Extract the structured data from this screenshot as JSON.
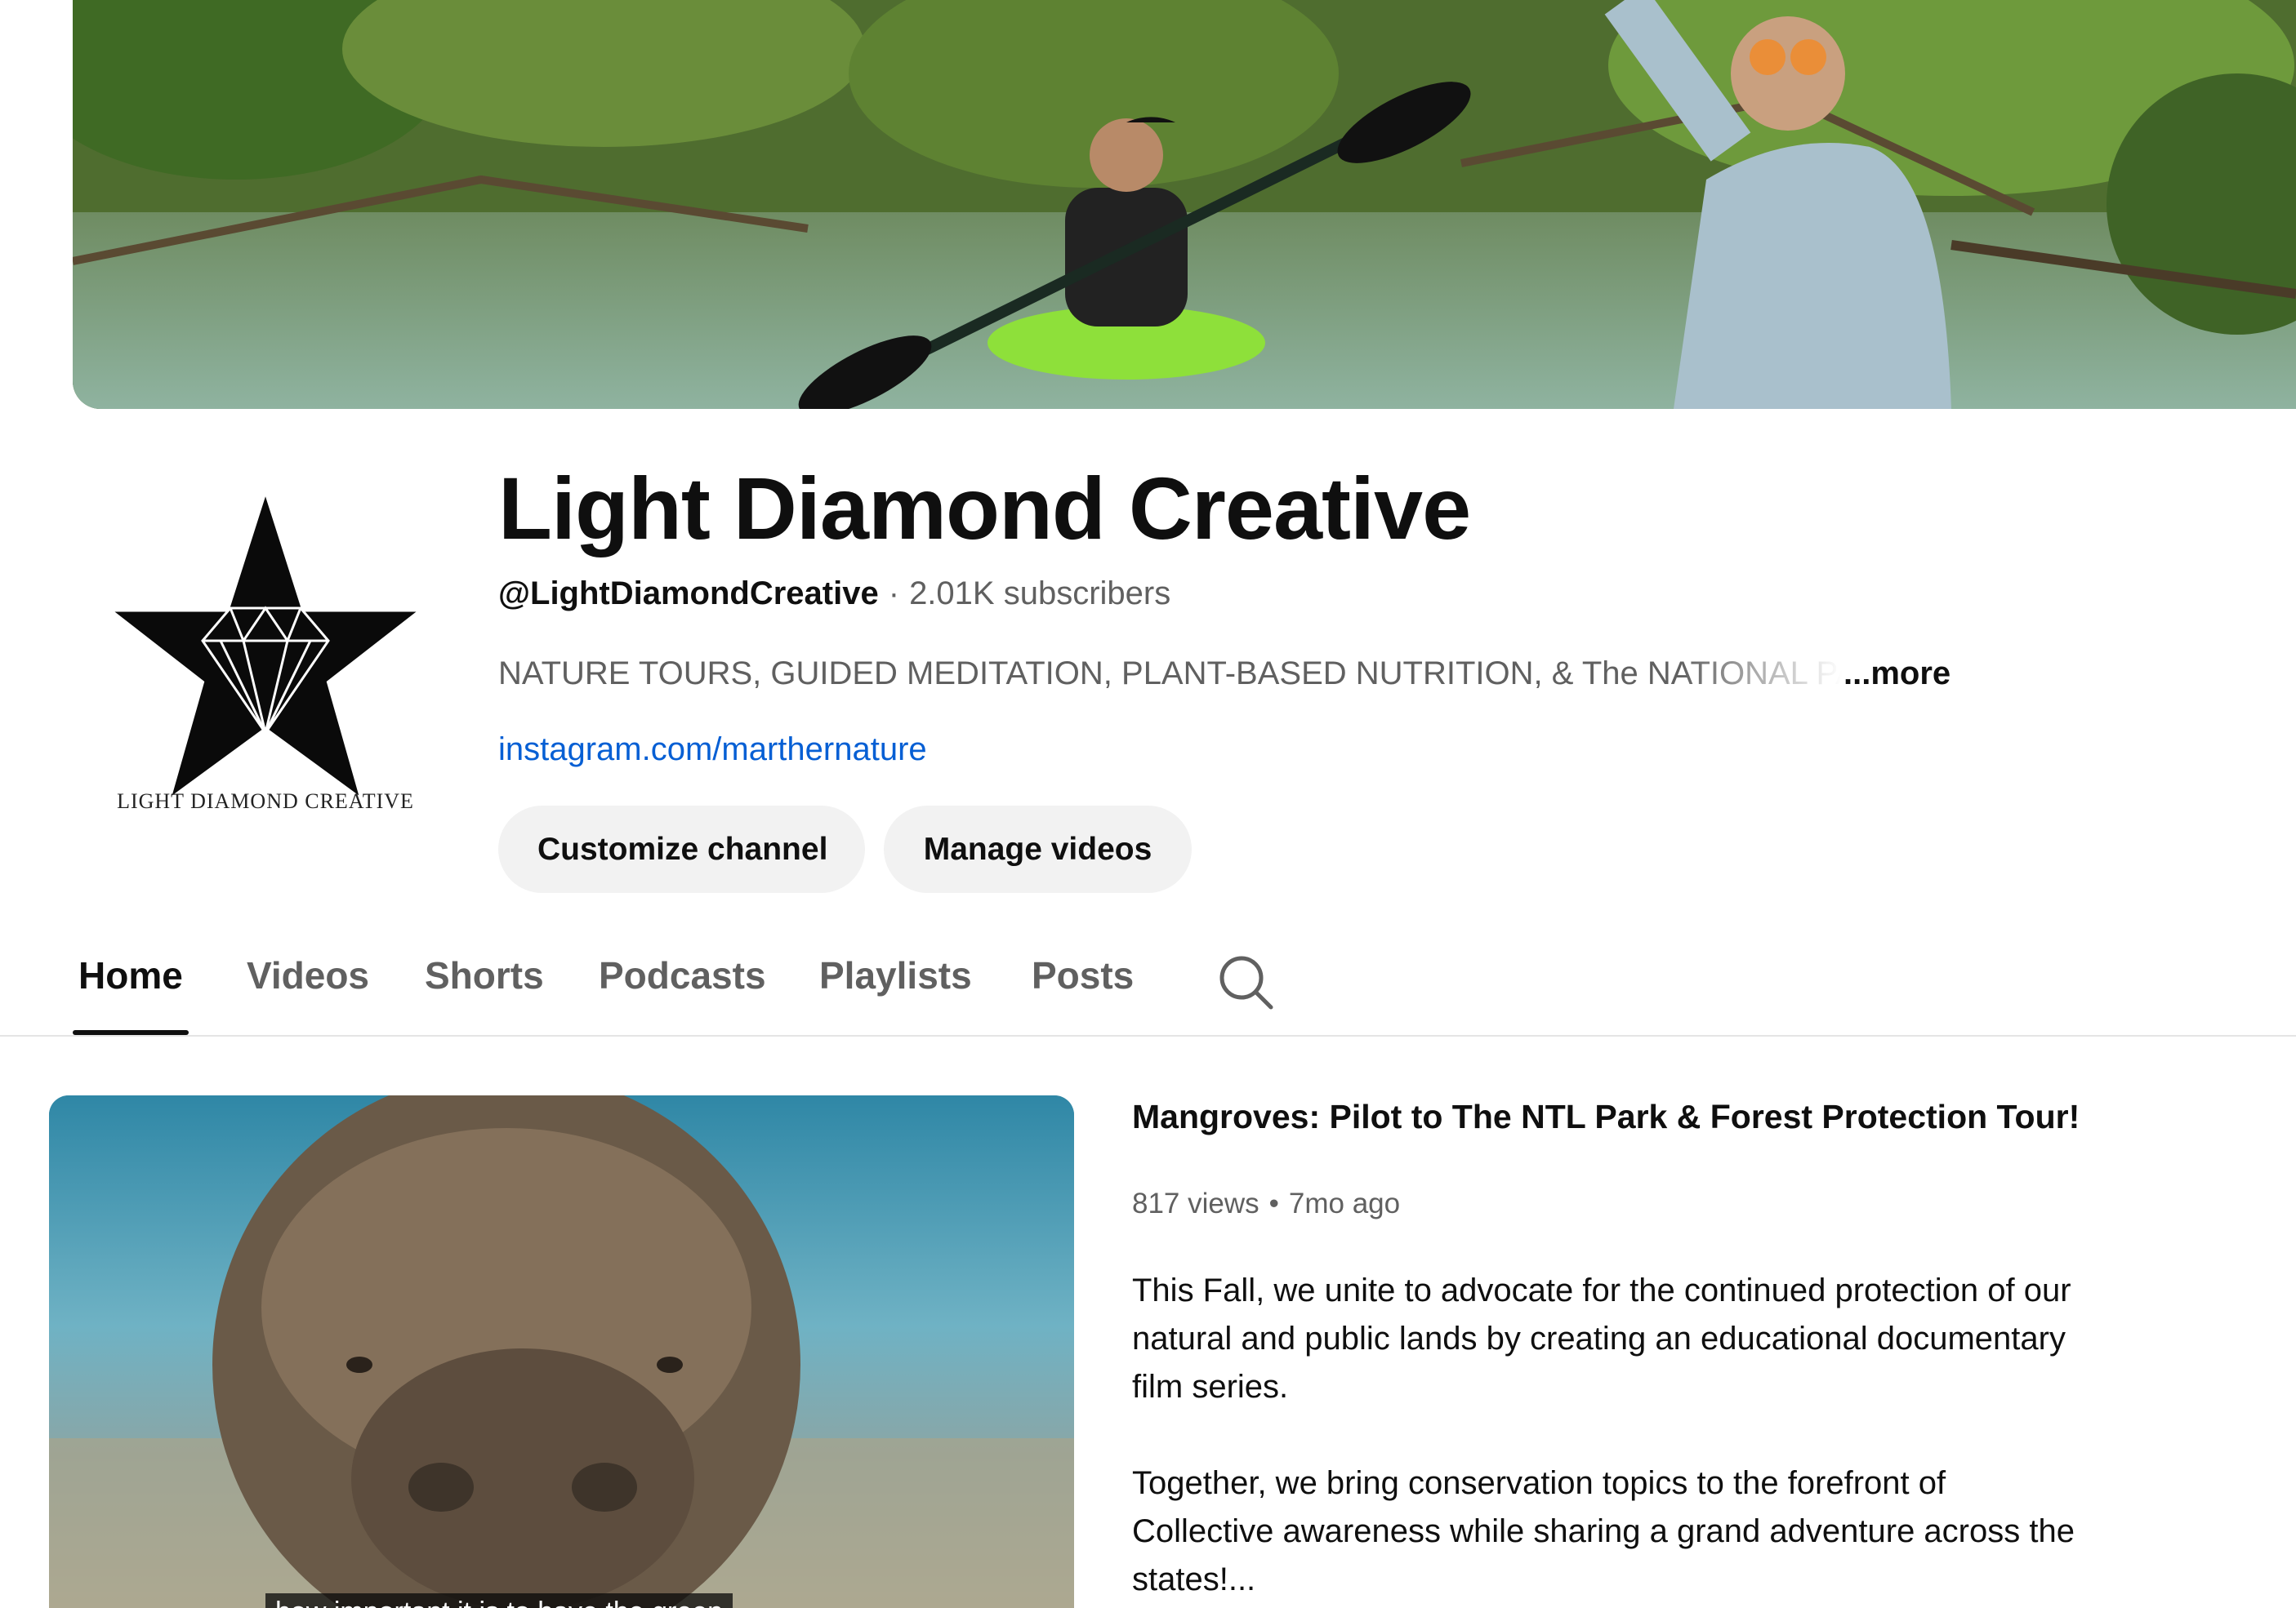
{
  "channel": {
    "name": "Light Diamond Creative",
    "handle": "@LightDiamondCreative",
    "separator": "·",
    "subscribers": "2.01K subscribers",
    "description": "NATURE TOURS, GUIDED MEDITATION, PLANT-BASED NUTRITION, & The NATIONAL PARKS",
    "more_label": "...more",
    "link": "instagram.com/marthernature",
    "avatar_caption": "LIGHT DIAMOND CREATIVE"
  },
  "actions": {
    "customize_label": "Customize channel",
    "manage_label": "Manage videos"
  },
  "tabs": [
    {
      "label": "Home",
      "active": true
    },
    {
      "label": "Videos"
    },
    {
      "label": "Shorts"
    },
    {
      "label": "Podcasts"
    },
    {
      "label": "Playlists"
    },
    {
      "label": "Posts"
    }
  ],
  "icons": {
    "search": "search-icon"
  },
  "featured": {
    "title": "Mangroves: Pilot to The NTL Park & Forest Protection Tour!",
    "views": "817 views",
    "dot": "•",
    "age": "7mo ago",
    "description_p1": "This Fall, we unite to advocate for the continued protection of our natural and public lands by creating an educational documentary film series.",
    "description_p2": "Together, we bring conservation topics to the forefront of Collective awareness while sharing a grand adventure across the states!...",
    "caption": "how important it is to have the green"
  },
  "colors": {
    "link": "#065fd4",
    "button_bg": "#f2f2f2",
    "secondary_text": "#606060",
    "primary_text": "#0f0f0f"
  }
}
